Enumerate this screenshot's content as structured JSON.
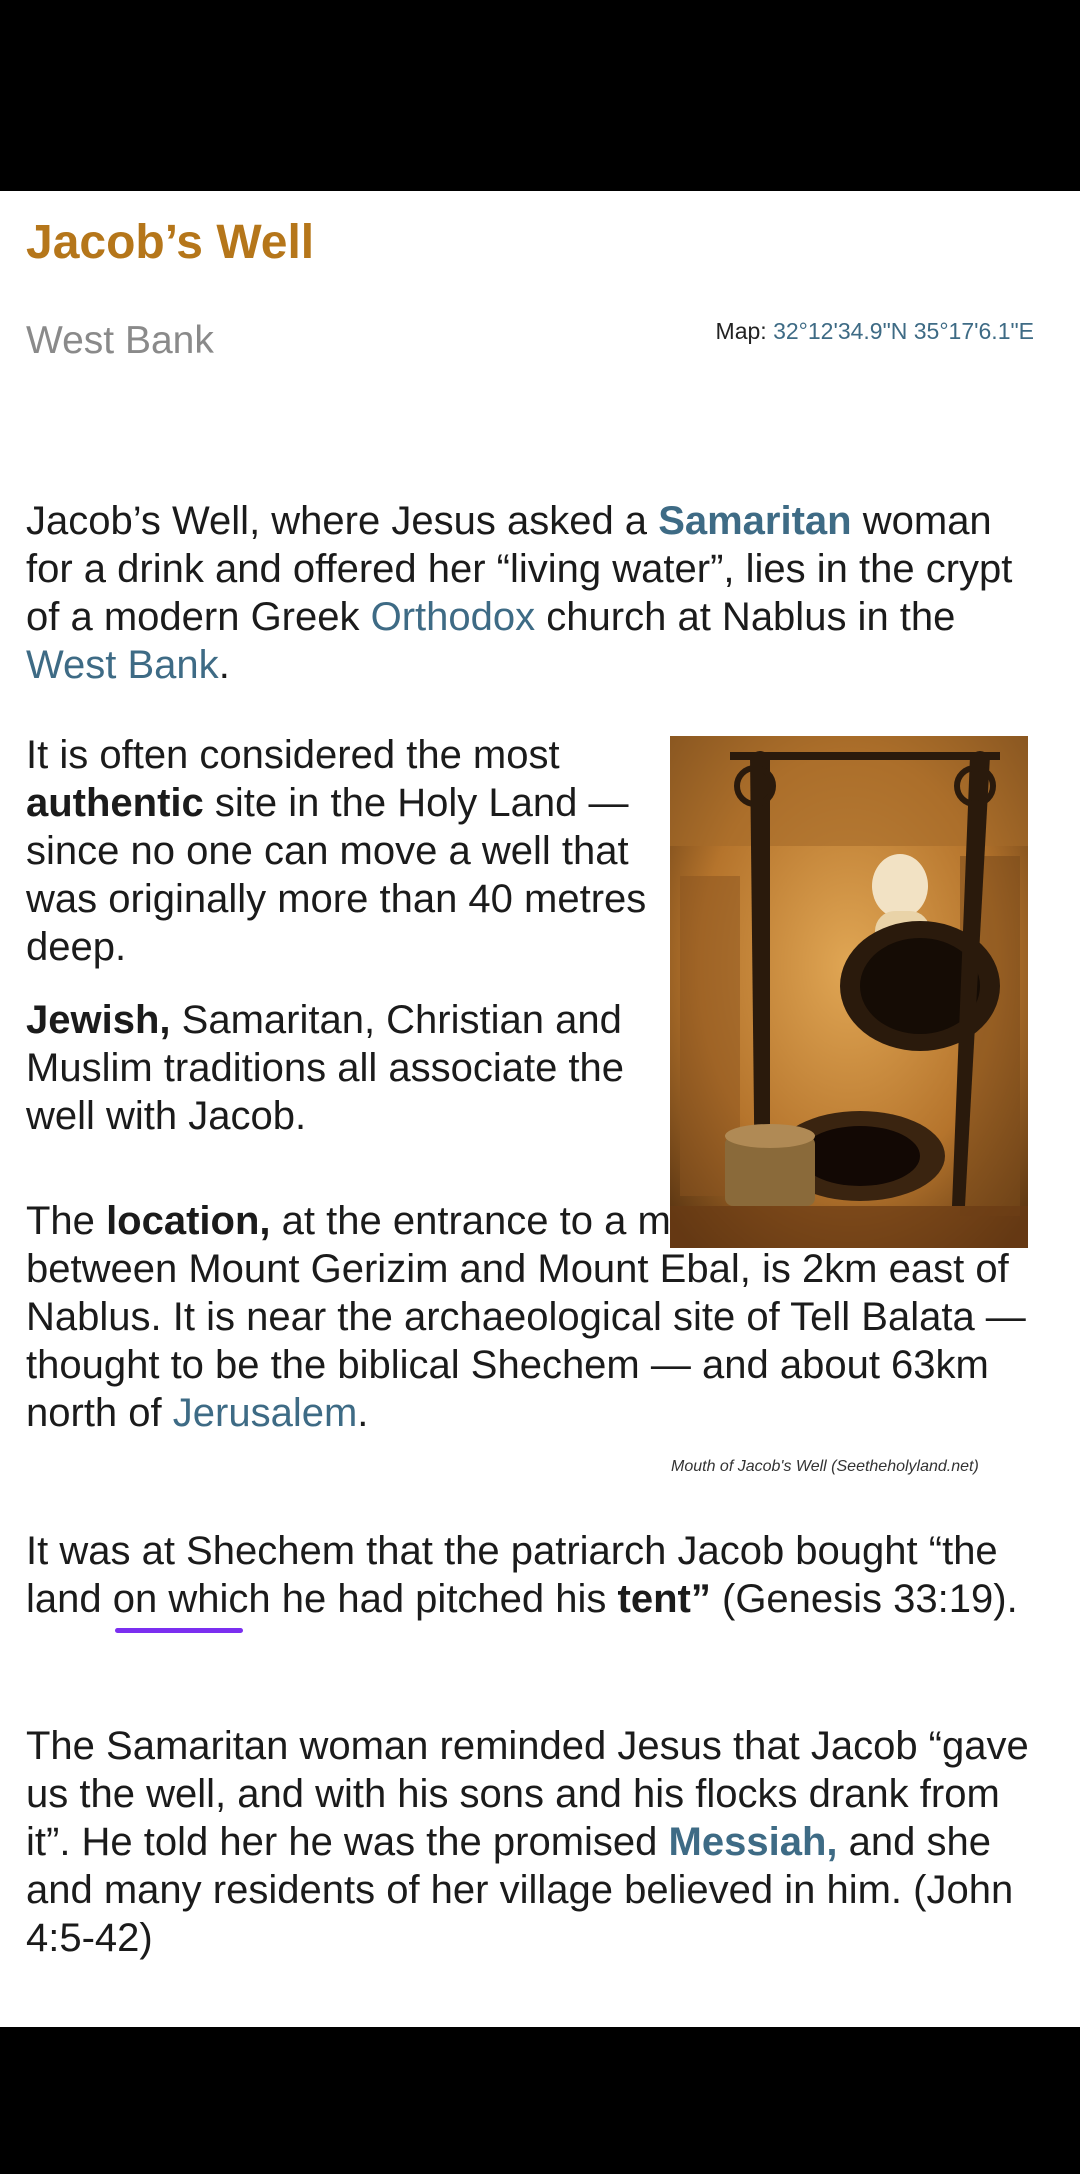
{
  "header": {
    "title": "Jacob’s Well",
    "subtitle": "West Bank",
    "map_label": "Map:",
    "map_coords": "32°12'34.9\"N 35°17'6.1\"E"
  },
  "paragraphs": {
    "p1": {
      "t1": "Jacob’s Well, where Jesus asked a",
      "link_samaritan": "Samaritan",
      "t2": "woman for a drink and offered her “living water”, lies in the crypt of a modern Greek",
      "link_orthodox": "Orthodox",
      "t3": "church at Nablus in the",
      "link_westbank": "West Bank",
      "t4": "."
    },
    "p2": {
      "t1": "It is often considered the most",
      "bold": "authentic",
      "t2": "site in the Holy Land — since no one can move a well that was originally more than 40 metres deep."
    },
    "p3": {
      "bold": "Jewish,",
      "t1": "Samaritan, Christian and Muslim traditions all associate the well with Jacob."
    },
    "p4": {
      "t1": "The",
      "bold": "location,",
      "t2": "at the entrance to a mountain pass between Mount Gerizim and Mount Ebal, is 2km east of Nablus. It is near the archaeological site of Tell Balata — thought to be the biblical Shechem — and about 63km north of",
      "link_jerusalem": "Jerusalem",
      "t3": "."
    },
    "p5": {
      "t1": "It was at Shechem that the patriarch Jacob bought “the land on which he had pitched his",
      "bold": "tent”",
      "t2": "(Genesis 33:19)."
    },
    "p6": {
      "t1": "The Samaritan woman reminded Jesus that Jacob “gave us the well, and with his sons and his flocks drank from it”. He told her he was the promised",
      "link_messiah": "Messiah,",
      "t2": "and she and many residents of her village believed in him. (John 4:5-42)"
    }
  },
  "figure": {
    "caption": "Mouth of Jacob's Well (Seetheholyland.net)",
    "image_icon": "well-photo",
    "colors": {
      "warm": "#c98a3a",
      "dark": "#2a1a0c"
    }
  },
  "colors": {
    "title": "#b5761a",
    "link": "#3e6b85",
    "underline": "#7b2ff0"
  }
}
